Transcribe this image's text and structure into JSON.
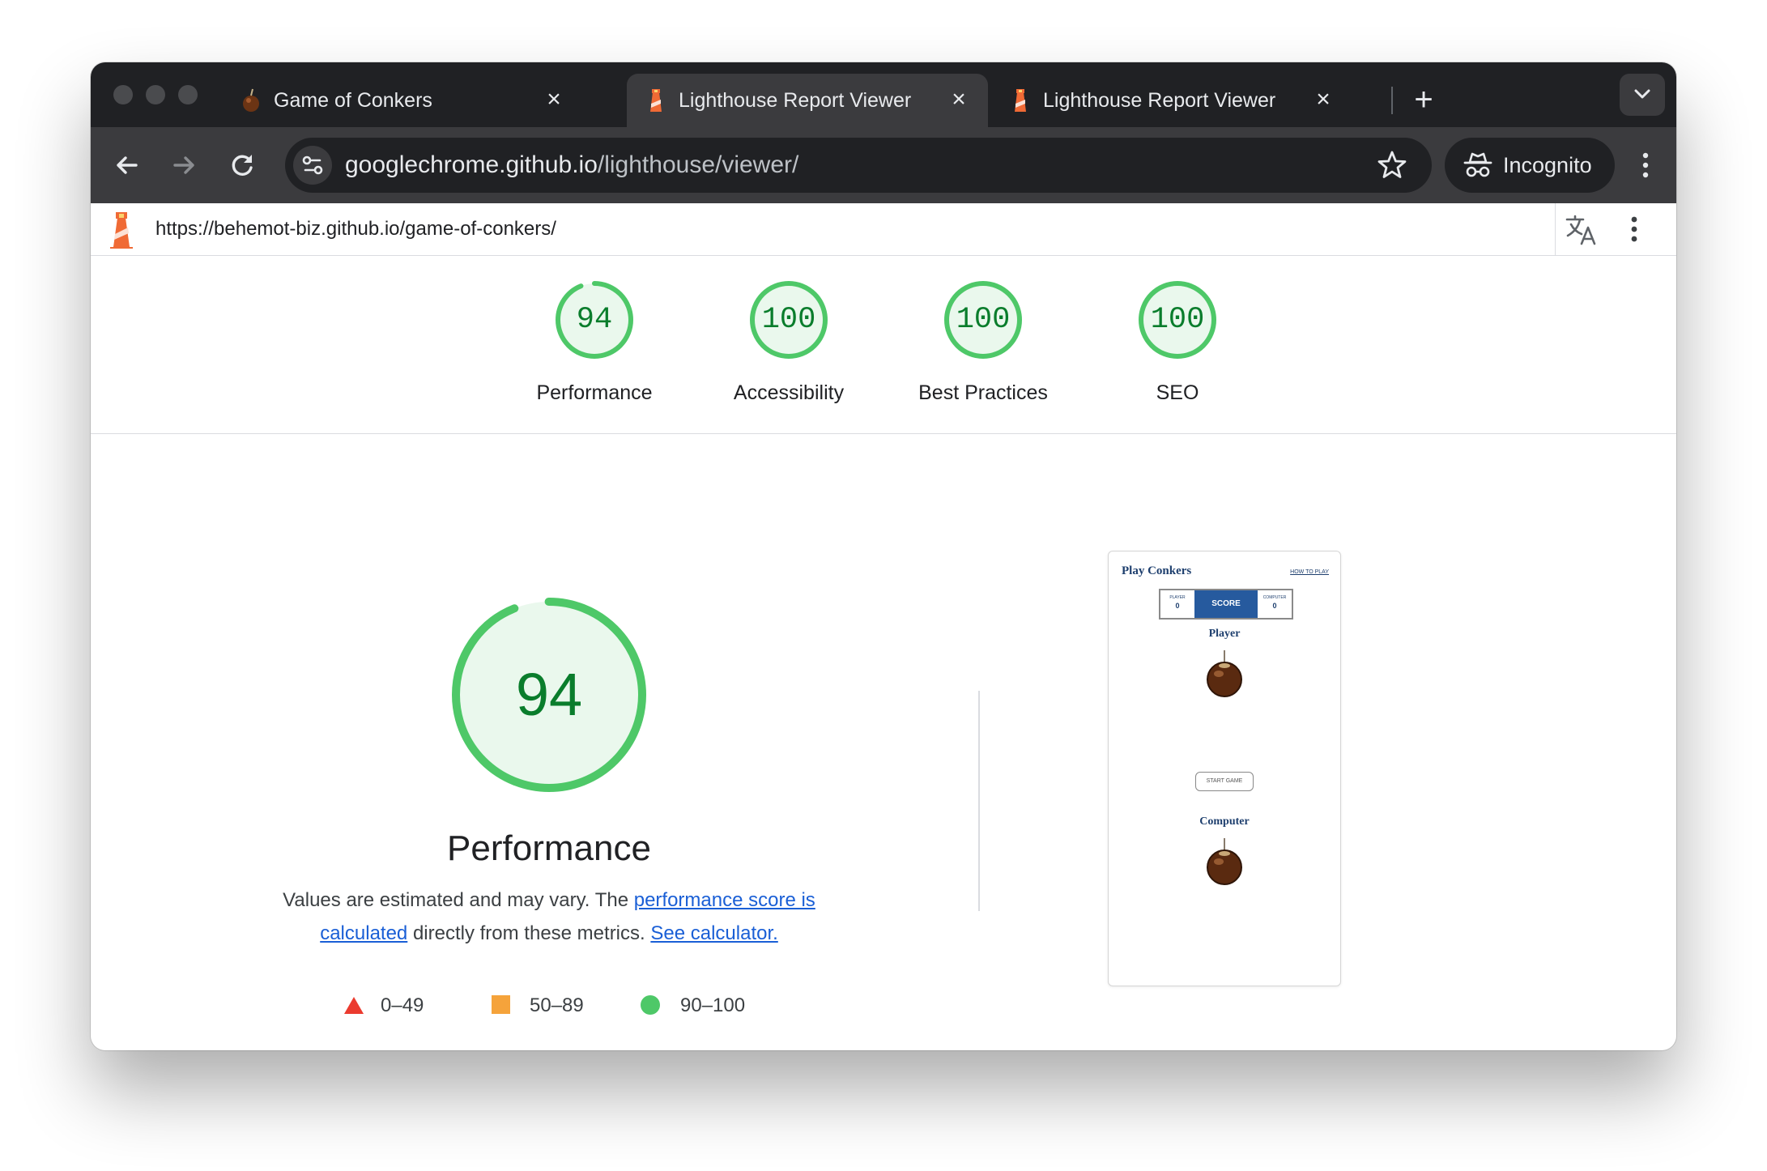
{
  "browser": {
    "tabs": [
      {
        "title": "Game of Conkers",
        "active": false
      },
      {
        "title": "Lighthouse Report Viewer",
        "active": true
      },
      {
        "title": "Lighthouse Report Viewer",
        "active": false
      }
    ],
    "address": {
      "host": "googlechrome.github.io",
      "path": "/lighthouse/viewer/"
    },
    "profile_label": "Incognito"
  },
  "viewer": {
    "report_url": "https://behemot-biz.github.io/game-of-conkers/"
  },
  "categories": [
    {
      "label": "Performance",
      "score": 94
    },
    {
      "label": "Accessibility",
      "score": 100
    },
    {
      "label": "Best Practices",
      "score": 100
    },
    {
      "label": "SEO",
      "score": 100
    }
  ],
  "performance": {
    "score": 94,
    "title": "Performance",
    "desc_part1": "Values are estimated and may vary. The ",
    "desc_link1": "performance score is calculated",
    "desc_part2": " directly from these metrics. ",
    "desc_link2": "See calculator.",
    "legend": [
      {
        "range": "0–49",
        "shape": "triangle",
        "color": "#eb3b2f"
      },
      {
        "range": "50–89",
        "shape": "square",
        "color": "#f5a33b"
      },
      {
        "range": "90–100",
        "shape": "circle",
        "color": "#4ec868"
      }
    ]
  },
  "screenshot": {
    "title": "Play Conkers",
    "how_to": "HOW TO PLAY",
    "player_small": "PLAYER",
    "player_score": "0",
    "score_label": "SCORE",
    "computer_small": "COMPUTER",
    "computer_score": "0",
    "player_label": "Player",
    "start_label": "START GAME",
    "computer_label": "Computer"
  },
  "colors": {
    "good": "#0a7d2c",
    "good_ring": "#4ec868",
    "good_fill": "#eaf8ed",
    "link": "#1a5fd6"
  }
}
